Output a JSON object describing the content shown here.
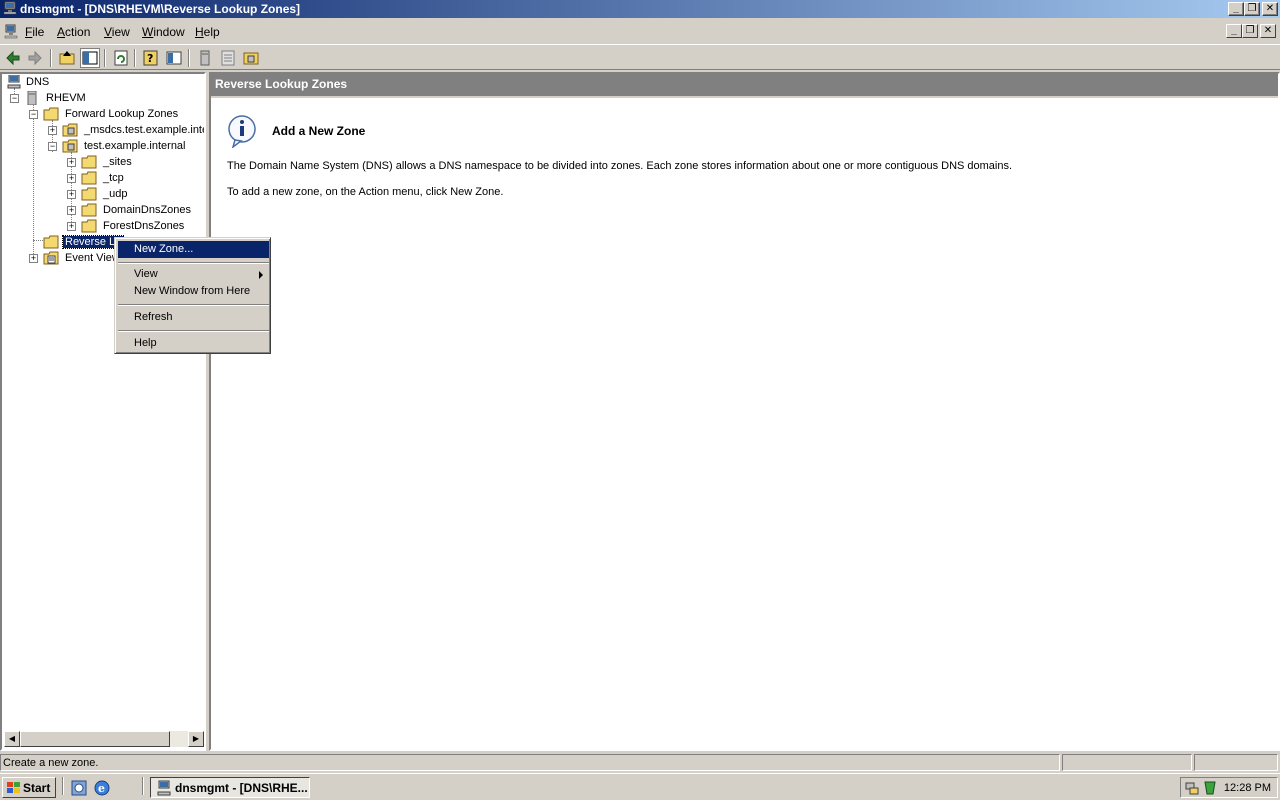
{
  "window": {
    "title": "dnsmgmt - [DNS\\RHEVM\\Reverse Lookup Zones]",
    "caption_buttons": [
      "minimize-icon",
      "restore-icon",
      "close-icon"
    ]
  },
  "menubar": {
    "items": [
      {
        "label": "File",
        "access": "F"
      },
      {
        "label": "Action",
        "access": "A"
      },
      {
        "label": "View",
        "access": "V"
      },
      {
        "label": "Window",
        "access": "W"
      },
      {
        "label": "Help",
        "access": "H"
      }
    ]
  },
  "toolbar": {
    "buttons": [
      "back-arrow-icon",
      "forward-arrow-icon",
      "up-folder-icon",
      "show-hide-tree-icon",
      "refresh-icon",
      "help-properties-icon",
      "export-list-icon",
      "server-icon",
      "list-icon",
      "zone-icon"
    ]
  },
  "tree": {
    "root": "DNS",
    "server": "RHEVM",
    "forward": "Forward Lookup Zones",
    "msdcs": "_msdcs.test.example.inte",
    "testzone": "test.example.internal",
    "sites": "_sites",
    "tcp": "_tcp",
    "udp": "_udp",
    "domaindns": "DomainDnsZones",
    "forestdns": "ForestDnsZones",
    "reverse": "Reverse Lo",
    "eventviewer": "Event View"
  },
  "rightpane": {
    "header": "Reverse Lookup Zones",
    "heading": "Add a New Zone",
    "description": "The Domain Name System (DNS) allows a DNS namespace to be divided into zones. Each zone stores information about one or more contiguous DNS domains.",
    "instruction": "To add a new zone, on the Action menu, click New Zone."
  },
  "context_menu": {
    "new_zone": "New Zone...",
    "view": "View",
    "new_window": "New Window from Here",
    "refresh": "Refresh",
    "help": "Help"
  },
  "statusbar": {
    "text": "Create a new zone."
  },
  "taskbar": {
    "start": "Start",
    "task": "dnsmgmt - [DNS\\RHE...",
    "clock": "12:28 PM"
  },
  "colors": {
    "title_active": "#0a246a",
    "selection": "#0a246a",
    "face": "#d4d0c8",
    "pane_header": "#808080"
  }
}
